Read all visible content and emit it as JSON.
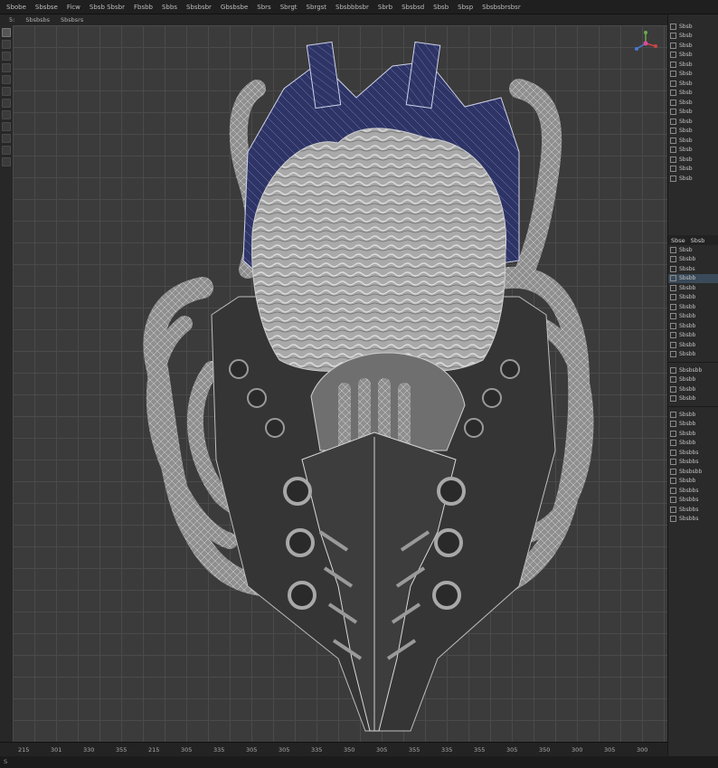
{
  "menubar": {
    "items": [
      "Sbobe",
      "Sbsbse",
      "Ficw",
      "Sbsb Sbsbr",
      "Fbsbb",
      "Sbbs",
      "Sbsbsbr",
      "Gbsbsbe",
      "Sbrs",
      "Sbrgt",
      "Sbrgst",
      "Sbsbbbsbr",
      "Sbrb",
      "Sbsbsd",
      "Sbsb",
      "Sbsp",
      "Sbsbsbrsbsr"
    ]
  },
  "subbar": {
    "items": [
      "5:",
      "Sbsbsbs",
      "Sbsbsrs"
    ]
  },
  "ruler": {
    "ticks": [
      "215",
      "301",
      "330",
      "355",
      "215",
      "305",
      "335",
      "305",
      "305",
      "335",
      "350",
      "305",
      "355",
      "335",
      "355",
      "305",
      "350",
      "300",
      "305",
      "300"
    ]
  },
  "status": {
    "left": "S"
  },
  "outliner": {
    "rows": [
      "Sbsb",
      "Sbsb",
      "Sbsb",
      "Sbsb",
      "Sbsb",
      "Sbsb",
      "Sbsb",
      "Sbsb",
      "Sbsb",
      "Sbsb",
      "Sbsb",
      "Sbsb",
      "Sbsb",
      "Sbsb",
      "Sbsb",
      "Sbsb",
      "Sbsb"
    ]
  },
  "properties": {
    "tabs": [
      "Sbse",
      "Sbsb"
    ],
    "rows": [
      "Sbsb",
      "Sbsbb",
      "Sbsbs",
      "Sbsbb",
      "Sbsbb",
      "Sbsbb",
      "Sbsbb",
      "Sbsbb",
      "Sbsbb",
      "Sbsbb",
      "Sbsbb",
      "Sbsbb",
      "Sbsbsbb",
      "Sbsbb",
      "Sbsbb",
      "Sbsbb",
      "Sbsbb",
      "Sbsbb",
      "Sbsbb",
      "Sbsbb",
      "Sbsbbs",
      "Sbsbbs",
      "Sbsbsbb",
      "Sbsbb",
      "Sbsbbs",
      "Sbsbbs",
      "Sbsbbs",
      "Sbsbbs"
    ]
  },
  "colors": {
    "accent": "#3a4a5a",
    "mesh_blue": "#2e3566"
  }
}
